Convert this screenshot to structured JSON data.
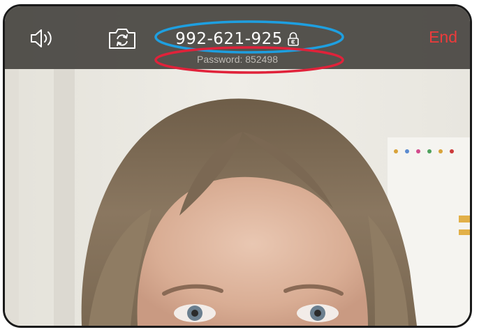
{
  "call": {
    "meeting_id": "992-621-925",
    "password_line": "Password: 852498",
    "end_label": "End"
  },
  "icons": {
    "speaker": "speaker-icon",
    "flip_camera": "camera-flip-icon",
    "lock": "lock-icon"
  },
  "annotation_colors": {
    "meeting_id_highlight": "#1e9fe0",
    "password_highlight": "#e0223a"
  },
  "colors": {
    "end_button": "#ee3b3b",
    "top_bar": "#46443f"
  }
}
